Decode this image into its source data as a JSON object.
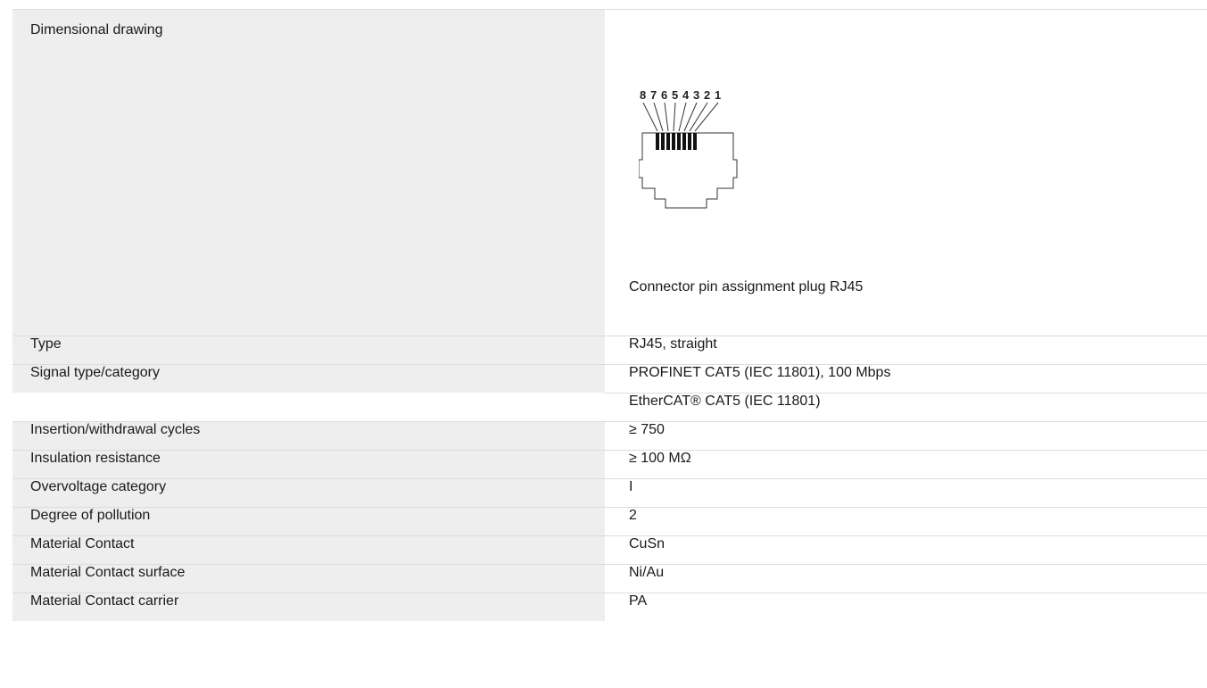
{
  "drawing": {
    "label": "Dimensional drawing",
    "pins": [
      "8",
      "7",
      "6",
      "5",
      "4",
      "3",
      "2",
      "1"
    ],
    "caption": "Connector pin assignment plug RJ45"
  },
  "rows": [
    {
      "label": "Type",
      "values": [
        "RJ45, straight"
      ]
    },
    {
      "label": "Signal type/category",
      "values": [
        "PROFINET CAT5 (IEC 11801), 100 Mbps",
        "EtherCAT® CAT5 (IEC 11801)"
      ]
    },
    {
      "label": "Insertion/withdrawal cycles",
      "values": [
        "≥ 750"
      ]
    },
    {
      "label": "Insulation resistance",
      "values": [
        "≥ 100 MΩ"
      ]
    },
    {
      "label": "Overvoltage category",
      "values": [
        "I"
      ]
    },
    {
      "label": "Degree of pollution",
      "values": [
        "2"
      ]
    },
    {
      "label": "Material Contact",
      "values": [
        "CuSn"
      ]
    },
    {
      "label": "Material Contact surface",
      "values": [
        "Ni/Au"
      ]
    },
    {
      "label": "Material Contact carrier",
      "values": [
        "PA"
      ]
    }
  ]
}
